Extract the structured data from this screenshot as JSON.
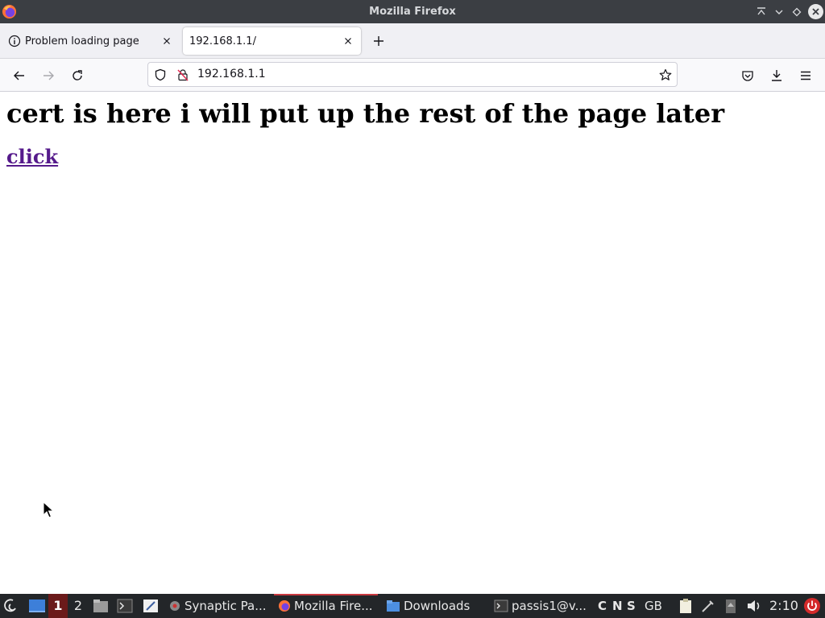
{
  "window": {
    "title": "Mozilla Firefox"
  },
  "tabs": [
    {
      "label": "Problem loading page",
      "icon": "info-icon",
      "active": false
    },
    {
      "label": "192.168.1.1/",
      "active": true
    }
  ],
  "navbar": {
    "url": "192.168.1.1"
  },
  "page": {
    "heading": "cert is here i will put up the rest of the page later",
    "link": "click"
  },
  "taskbar": {
    "workspaces": [
      "1",
      "2"
    ],
    "tasks": [
      {
        "label": "Synaptic Pa...",
        "icon": "synaptic-icon"
      },
      {
        "label": "Mozilla Fire...",
        "icon": "firefox-icon",
        "active": true
      },
      {
        "label": "Downloads",
        "icon": "folder-icon"
      },
      {
        "label": "passis1@v...",
        "icon": "terminal-icon"
      }
    ],
    "indicators": [
      "C",
      "N",
      "S"
    ],
    "keyboard_layout": "GB",
    "clock": "2:10"
  },
  "colors": {
    "titlebar": "#3b3e43",
    "taskbar": "#232629",
    "link_visited": "#551a8b",
    "active_workspace": "#6b1a1a"
  }
}
